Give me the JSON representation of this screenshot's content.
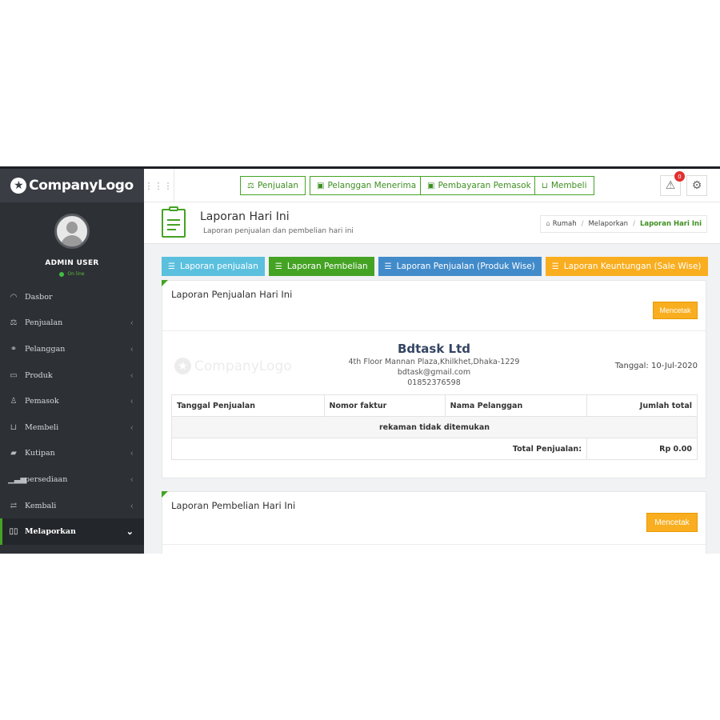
{
  "brand": {
    "name": "CompanyLogo"
  },
  "user": {
    "name": "ADMIN USER",
    "status": "On line"
  },
  "sidebar": {
    "items": [
      {
        "label": "Dasbor",
        "icon": "dashboard-icon",
        "has_children": false
      },
      {
        "label": "Penjualan",
        "icon": "scale-icon",
        "has_children": true
      },
      {
        "label": "Pelanggan",
        "icon": "handshake-icon",
        "has_children": true
      },
      {
        "label": "Produk",
        "icon": "box-icon",
        "has_children": true
      },
      {
        "label": "Pemasok",
        "icon": "user-icon",
        "has_children": true
      },
      {
        "label": "Membeli",
        "icon": "cart-icon",
        "has_children": true
      },
      {
        "label": "Kutipan",
        "icon": "book-icon",
        "has_children": true
      },
      {
        "label": "persediaan",
        "icon": "bar-chart-icon",
        "has_children": true
      },
      {
        "label": "Kembali",
        "icon": "exchange-icon",
        "has_children": true
      },
      {
        "label": "Melaporkan",
        "icon": "book-open-icon",
        "has_children": true,
        "active": true
      }
    ]
  },
  "topbar": {
    "quick_links": [
      {
        "label": "Penjualan",
        "icon": "scale-icon"
      },
      {
        "label": "Pelanggan Menerima",
        "icon": "money-icon"
      },
      {
        "label": "Pembayaran Pemasok",
        "icon": "money-icon"
      },
      {
        "label": "Membeli",
        "icon": "cart-icon"
      }
    ],
    "notification_count": "0"
  },
  "page": {
    "title": "Laporan Hari Ini",
    "subtitle": "Laporan penjualan dan pembelian hari ini",
    "breadcrumb": [
      "Rumah",
      "Melaporkan",
      "Laporan Hari Ini"
    ]
  },
  "tabs": [
    {
      "label": "Laporan penjualan",
      "color": "#5bc0de"
    },
    {
      "label": "Laporan Pembelian",
      "color": "#45a324"
    },
    {
      "label": "Laporan Penjualan (Produk Wise)",
      "color": "#428bca"
    },
    {
      "label": "Laporan Keuntungan (Sale Wise)",
      "color": "#f9ae20"
    }
  ],
  "sales_panel": {
    "title": "Laporan Penjualan Hari Ini",
    "print_label": "Mencetak",
    "watermark": "CompanyLogo",
    "company": {
      "name": "Bdtask Ltd",
      "address": "4th Floor Mannan Plaza,Khilkhet,Dhaka-1229",
      "email": "bdtask@gmail.com",
      "phone": "01852376598"
    },
    "date_label": "Tanggal: 10-Jul-2020",
    "table": {
      "headers": [
        "Tanggal Penjualan",
        "Nomor faktur",
        "Nama Pelanggan",
        "Jumlah total"
      ],
      "empty_message": "rekaman tidak ditemukan",
      "total_label": "Total Penjualan:",
      "total_value": "Rp 0.00"
    }
  },
  "purchase_panel": {
    "title": "Laporan Pembelian Hari Ini",
    "print_label": "Mencetak"
  },
  "colors": {
    "accent": "#45a324",
    "warning": "#f9ae20",
    "sidebar": "#2d3035"
  }
}
